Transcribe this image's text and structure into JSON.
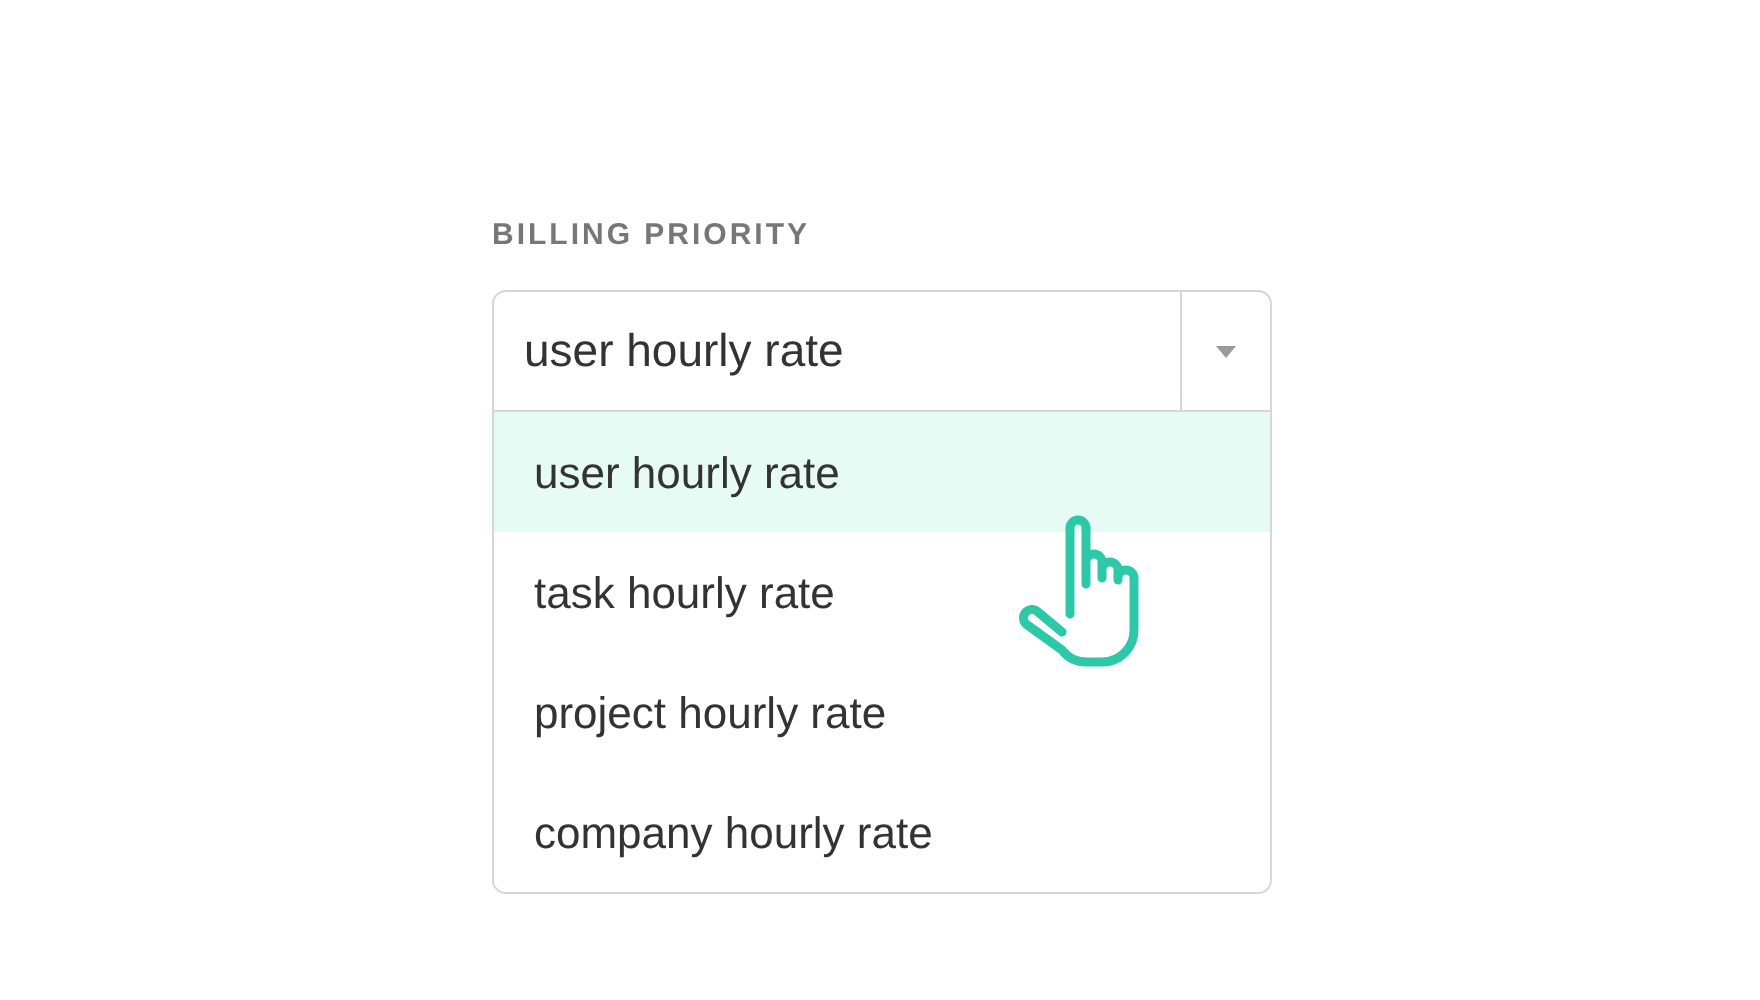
{
  "field": {
    "label": "BILLING PRIORITY",
    "value": "user hourly rate",
    "expanded": true
  },
  "options": [
    {
      "label": "user hourly rate",
      "selected": true
    },
    {
      "label": "task hourly rate",
      "selected": false
    },
    {
      "label": "project hourly rate",
      "selected": false
    },
    {
      "label": "company hourly rate",
      "selected": false
    }
  ]
}
